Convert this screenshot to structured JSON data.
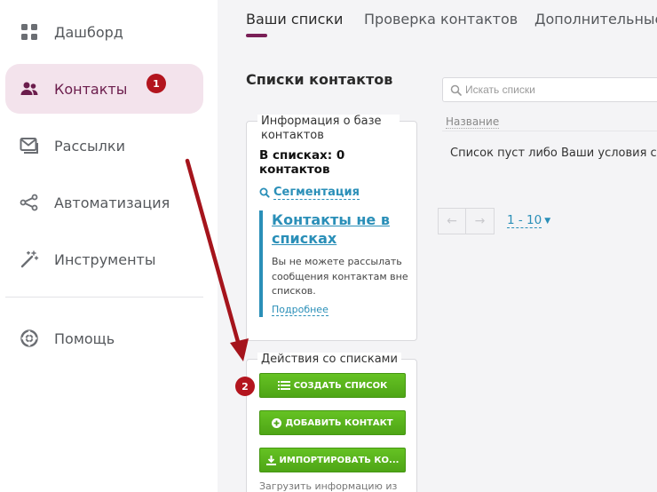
{
  "sidebar": {
    "items": [
      {
        "label": "Дашборд",
        "icon": "grid-icon"
      },
      {
        "label": "Контакты",
        "icon": "users-icon",
        "badge": "1"
      },
      {
        "label": "Рассылки",
        "icon": "mail-icon"
      },
      {
        "label": "Автоматизация",
        "icon": "share-nodes-icon"
      },
      {
        "label": "Инструменты",
        "icon": "magic-wand-icon"
      }
    ],
    "help": {
      "label": "Помощь",
      "icon": "lifebuoy-icon"
    }
  },
  "tabs": [
    {
      "label": "Ваши списки"
    },
    {
      "label": "Проверка контактов"
    },
    {
      "label": "Дополнительные"
    }
  ],
  "page": {
    "title": "Списки контактов"
  },
  "info": {
    "legend": "Информация о базе контактов",
    "in_lists": "В списках: 0 контактов",
    "segmentation": "Сегментация",
    "not_in_lists_title": "Контакты не в списках",
    "not_in_lists_desc": "Вы не можете рассылать сообщения контактам вне списков.",
    "more": "Подробнее"
  },
  "actions": {
    "legend": "Действия со списками",
    "badge": "2",
    "create": "СОЗДАТЬ СПИСОК",
    "add": "ДОБАВИТЬ КОНТАКТ",
    "import": "ИМПОРТИРОВАТЬ КО...",
    "upload_hint": "Загрузить информацию из"
  },
  "search": {
    "placeholder": "Искать списки"
  },
  "table": {
    "column": "Название",
    "empty": "Список пуст либо Ваши условия с"
  },
  "pager": {
    "prev": "←",
    "next": "→",
    "range": "1 - 10"
  },
  "colors": {
    "accent": "#7a1f57",
    "link": "#2a8fb8",
    "button": "#5bb41e",
    "badge": "#b3151e",
    "arrow": "#a5141c"
  }
}
